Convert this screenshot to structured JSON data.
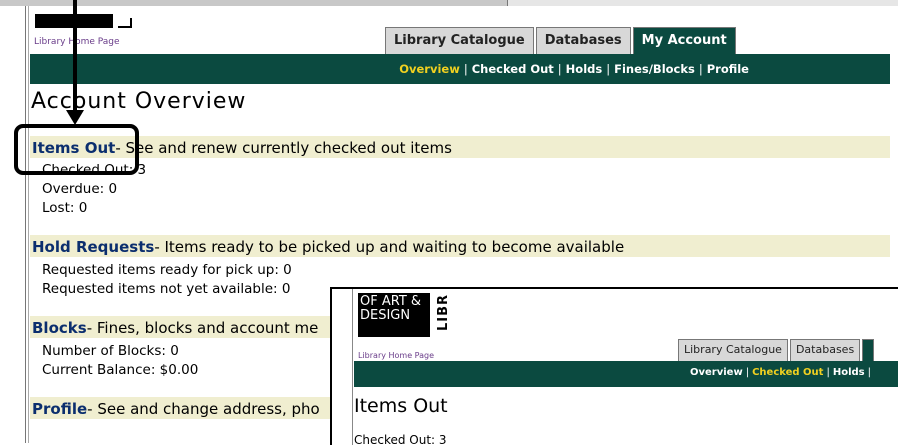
{
  "header": {
    "home_link": "Library Home Page",
    "tabs": [
      {
        "label": "Library Catalogue"
      },
      {
        "label": "Databases"
      },
      {
        "label": "My Account"
      }
    ],
    "subnav": [
      {
        "label": "Overview"
      },
      {
        "label": "Checked Out"
      },
      {
        "label": "Holds"
      },
      {
        "label": "Fines/Blocks"
      },
      {
        "label": "Profile"
      }
    ]
  },
  "page": {
    "title": "Account Overview",
    "sections": [
      {
        "heading": "Items Out",
        "desc": "- See and renew currently checked out items",
        "lines": [
          "Checked Out: 3",
          "Overdue: 0",
          "Lost: 0"
        ]
      },
      {
        "heading": "Hold Requests",
        "desc": "- Items ready to be picked up and waiting to become available",
        "lines": [
          "Requested items ready for pick up: 0",
          "Requested items not yet available: 0"
        ]
      },
      {
        "heading": "Blocks",
        "desc": "- Fines, blocks and account me",
        "lines": [
          "Number of Blocks: 0",
          "Current Balance: $0.00"
        ]
      },
      {
        "heading": "Profile",
        "desc": "- See and change address, pho",
        "lines": []
      }
    ]
  },
  "inset": {
    "logo_text": "OF ART &\nDESIGN",
    "logo_vertical": "LIBR",
    "home_link": "Library Home Page",
    "tabs": [
      {
        "label": "Library Catalogue"
      },
      {
        "label": "Databases"
      }
    ],
    "subnav": [
      {
        "label": "Overview"
      },
      {
        "label": "Checked Out"
      },
      {
        "label": "Holds"
      }
    ],
    "title": "Items Out",
    "peek_line": "Checked Out: 3"
  }
}
